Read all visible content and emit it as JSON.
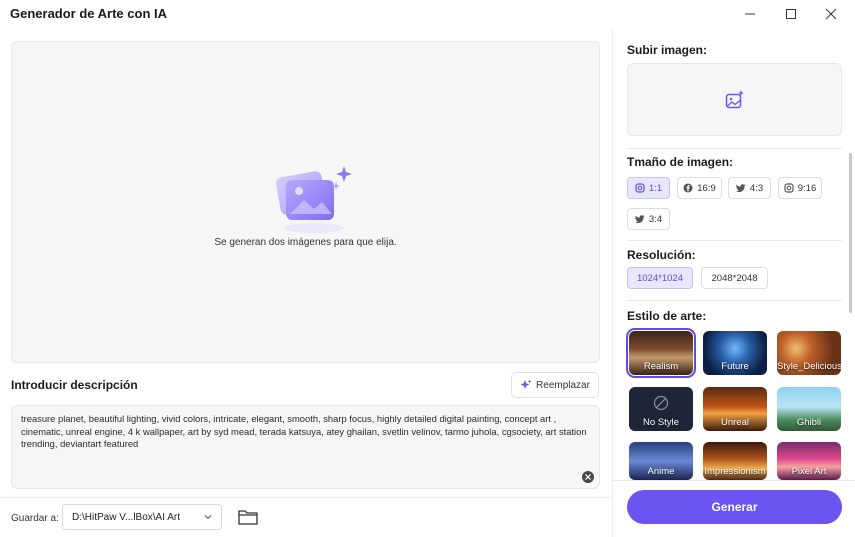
{
  "window": {
    "title": "Generador de Arte con IA"
  },
  "preview": {
    "message": "Se generan dos imágenes para que elija."
  },
  "description": {
    "title": "Introducir descripción",
    "replace_label": "Reemplazar",
    "text": "treasure planet, beautiful lighting, vivid colors, intricate, elegant, smooth, sharp focus, highly detailed digital painting, concept art , cinematic, unreal engine, 4 k wallpaper, art by syd mead, terada katsuya, atey ghailan, svetlin velinov, tarmo juhola, cgsociety, art station trending, deviantart featured"
  },
  "save": {
    "label": "Guardar a:",
    "path": "D:\\HitPaw V...lBox\\AI Art"
  },
  "upload": {
    "title": "Subir imagen:"
  },
  "size": {
    "title": "Tmaño de imagen:",
    "options": [
      {
        "label": "1:1",
        "icon": "instagram-icon",
        "active": true
      },
      {
        "label": "16:9",
        "icon": "facebook-icon",
        "active": false
      },
      {
        "label": "4:3",
        "icon": "twitter-icon",
        "active": false
      },
      {
        "label": "9:16",
        "icon": "instagram-icon",
        "active": false
      },
      {
        "label": "3:4",
        "icon": "twitter-icon",
        "active": false
      }
    ]
  },
  "resolution": {
    "title": "Resolución:",
    "options": [
      {
        "label": "1024*1024",
        "active": true
      },
      {
        "label": "2048*2048",
        "active": false
      }
    ]
  },
  "art_style": {
    "title": "Estilo de arte:",
    "styles": [
      {
        "label": "Realism",
        "selected": true
      },
      {
        "label": "Future",
        "selected": false
      },
      {
        "label": "Style_Delicious",
        "selected": false
      },
      {
        "label": "No Style",
        "selected": false
      },
      {
        "label": "Unreal",
        "selected": false
      },
      {
        "label": "Ghibli",
        "selected": false
      },
      {
        "label": "Anime",
        "selected": false
      },
      {
        "label": "Impressionism",
        "selected": false
      },
      {
        "label": "Pixel Art",
        "selected": false
      }
    ]
  },
  "generate": {
    "label": "Generar"
  },
  "colors": {
    "accent": "#6a55f2",
    "chip_active_bg": "#e8e6fd"
  }
}
